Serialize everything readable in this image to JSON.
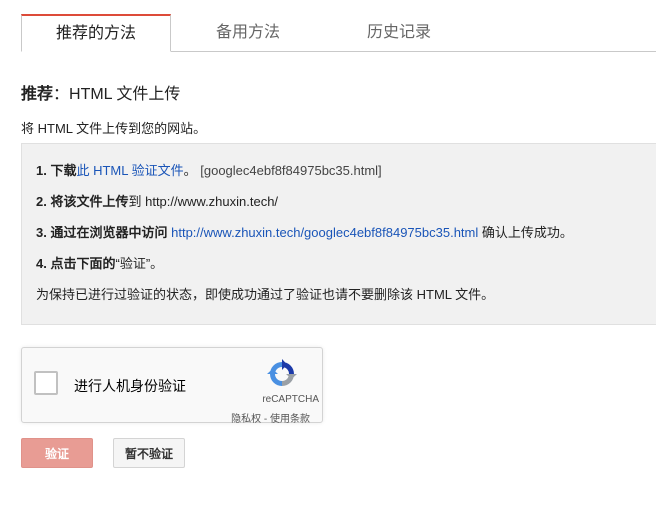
{
  "tabs": [
    {
      "label": "推荐的方法",
      "active": true
    },
    {
      "label": "备用方法",
      "active": false
    },
    {
      "label": "历史记录",
      "active": false
    }
  ],
  "heading": {
    "bold": "推荐",
    "rest": "：HTML 文件上传"
  },
  "subtitle": "将 HTML 文件上传到您的网站。",
  "steps": {
    "s1": {
      "num": "1. ",
      "bold": "下载",
      "link": "此 HTML 验证文件",
      "mid": "。 ",
      "file": "[googlec4ebf8f84975bc35.html]"
    },
    "s2": {
      "num": "2. ",
      "bold": "将该文件上传",
      "rest": "到 http://www.zhuxin.tech/"
    },
    "s3": {
      "num": "3. ",
      "bold": "通过在浏览器中访问",
      "link": "http://www.zhuxin.tech/googlec4ebf8f84975bc35.html",
      "rest": " 确认上传成功。"
    },
    "s4": {
      "num": "4. ",
      "bold": "点击下面的",
      "rest": "“验证”。"
    },
    "note": "为保持已进行过验证的状态，即使成功通过了验证也请不要删除该 HTML 文件。"
  },
  "recaptcha": {
    "label": "进行人机身份验证",
    "brand": "reCAPTCHA",
    "privacy": "隐私权",
    "sep": " - ",
    "terms": "使用条款"
  },
  "buttons": {
    "verify": "验证",
    "skip": "暂不验证"
  },
  "colors": {
    "accent": "#dd4b39",
    "link": "#1a55b8",
    "verify_bg": "#e89c94"
  }
}
